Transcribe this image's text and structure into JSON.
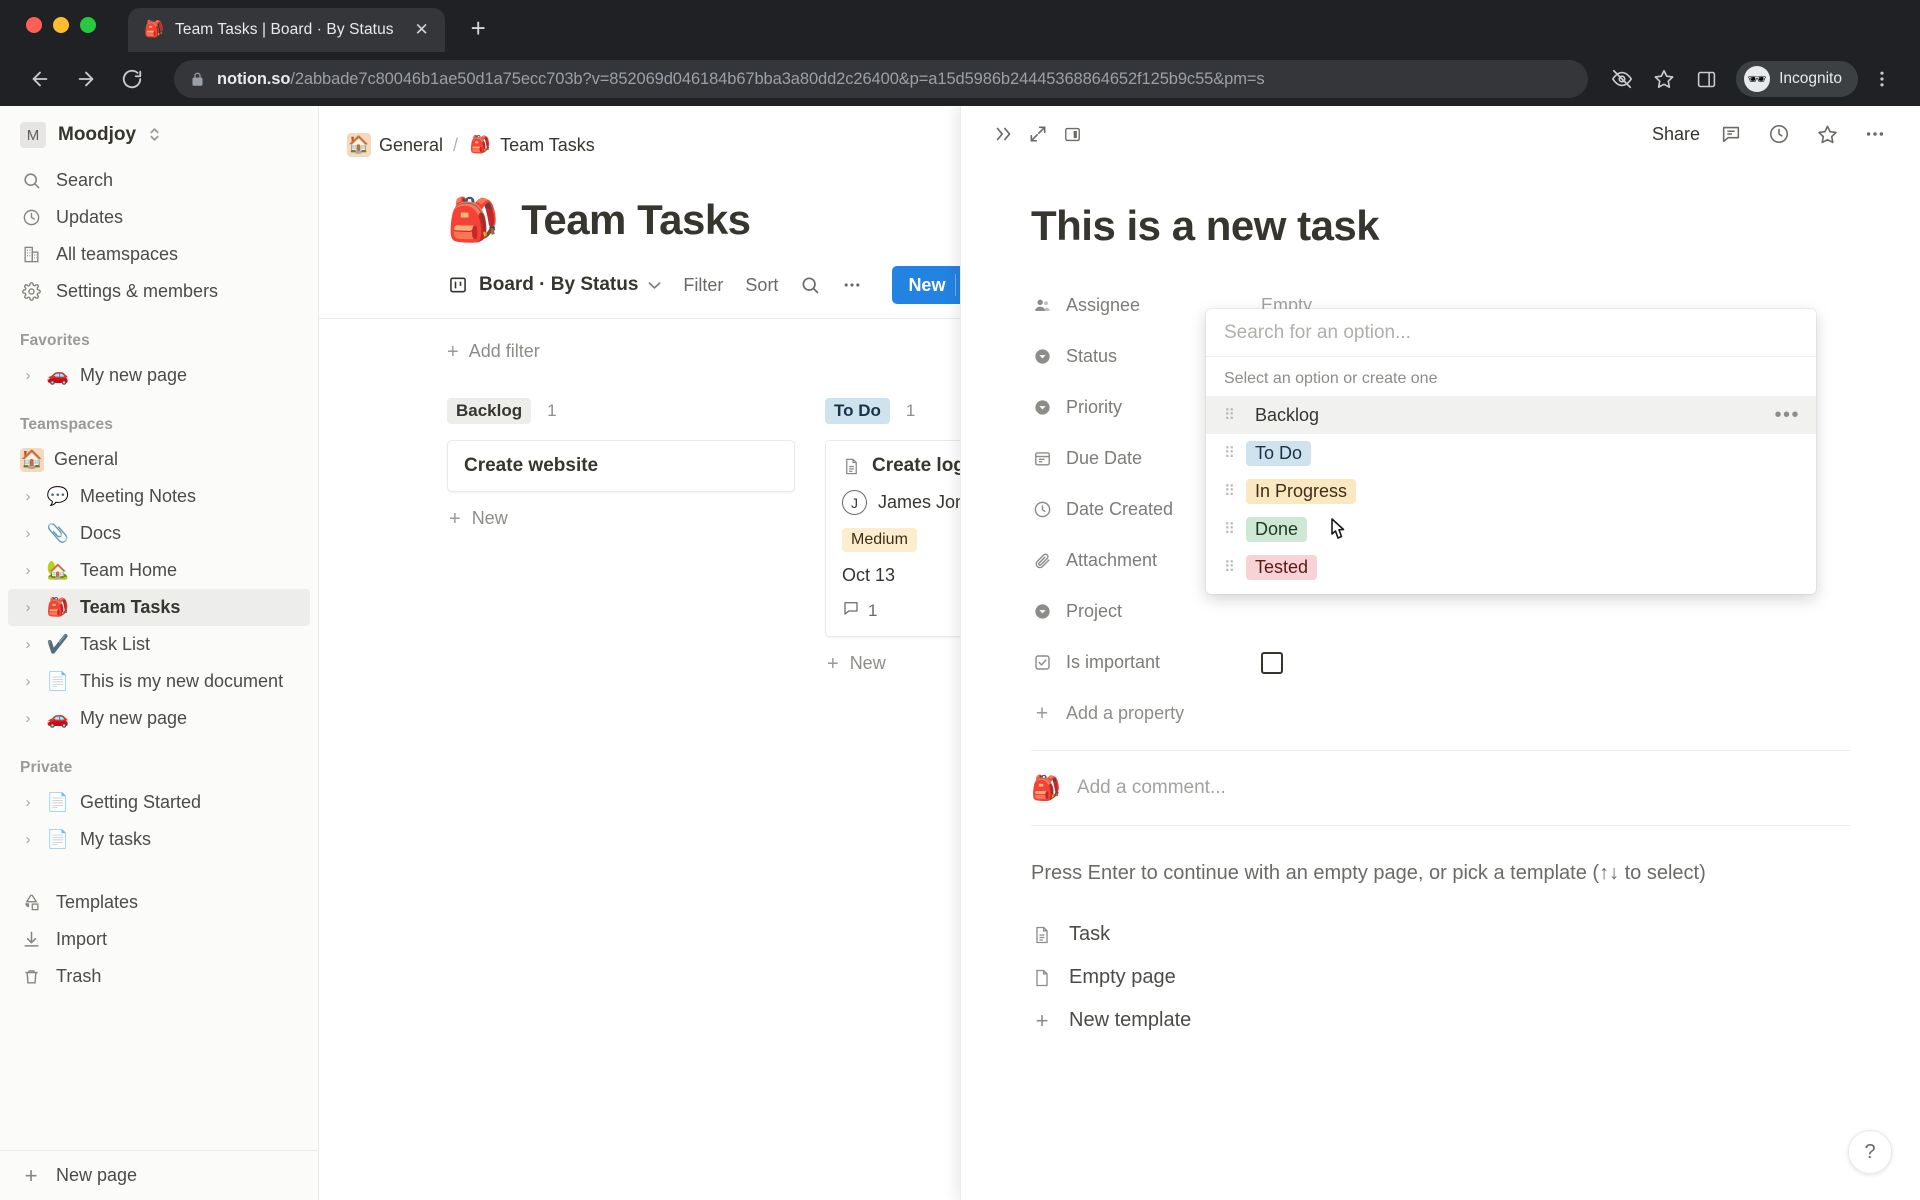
{
  "browser": {
    "tab": {
      "title": "Team Tasks | Board · By Status",
      "favicon": "🎒",
      "close": "✕"
    },
    "new_tab": "+",
    "url": {
      "host": "notion.so",
      "path": "/2abbade7c80046b1ae50d1a75ecc703b?v=852069d046184b67bba3a80dd2c26400&p=a15d5986b24445368864652f125b9c55&pm=s"
    },
    "profile": {
      "label": "Incognito",
      "avatar": "🕶"
    },
    "nav": {
      "back": "←",
      "forward": "→",
      "reload": "⟳"
    }
  },
  "sidebar": {
    "workspace": {
      "initial": "M",
      "name": "Moodjoy",
      "chevron": "⌃⌄"
    },
    "nav": [
      {
        "label": "Search",
        "icon": "search-icon"
      },
      {
        "label": "Updates",
        "icon": "clock-icon"
      },
      {
        "label": "All teamspaces",
        "icon": "building-icon"
      },
      {
        "label": "Settings & members",
        "icon": "gear-icon"
      }
    ],
    "sections": [
      {
        "title": "Favorites",
        "items": [
          {
            "label": "My new page",
            "emoji": "🚗",
            "chevron": true,
            "selected": false,
            "boxed": false
          }
        ]
      },
      {
        "title": "Teamspaces",
        "items": [
          {
            "label": "General",
            "emoji": "🏠",
            "chevron": false,
            "selected": false,
            "boxed": true
          },
          {
            "label": "Meeting Notes",
            "emoji": "💬",
            "chevron": true,
            "selected": false,
            "boxed": false
          },
          {
            "label": "Docs",
            "emoji": "📎",
            "chevron": true,
            "selected": false,
            "boxed": false
          },
          {
            "label": "Team Home",
            "emoji": "🏡",
            "chevron": true,
            "selected": false,
            "boxed": false
          },
          {
            "label": "Team Tasks",
            "emoji": "🎒",
            "chevron": true,
            "selected": true,
            "boxed": false
          },
          {
            "label": "Task List",
            "emoji": "✔️",
            "chevron": true,
            "selected": false,
            "boxed": false
          },
          {
            "label": "This is my new document",
            "emoji": "📄",
            "chevron": true,
            "selected": false,
            "boxed": false
          },
          {
            "label": "My new page",
            "emoji": "🚗",
            "chevron": true,
            "selected": false,
            "boxed": false
          }
        ]
      },
      {
        "title": "Private",
        "items": [
          {
            "label": "Getting Started",
            "emoji": "📄",
            "chevron": true,
            "selected": false,
            "boxed": false
          },
          {
            "label": "My tasks",
            "emoji": "📄",
            "chevron": true,
            "selected": false,
            "boxed": false
          }
        ]
      }
    ],
    "tools": [
      {
        "label": "Templates",
        "icon": "templates-icon"
      },
      {
        "label": "Import",
        "icon": "import-icon"
      },
      {
        "label": "Trash",
        "icon": "trash-icon"
      }
    ],
    "footer": {
      "label": "New page",
      "plus": "+"
    }
  },
  "board": {
    "breadcrumb": [
      {
        "label": "General",
        "emoji": "🏠",
        "boxed": true
      },
      {
        "label": "Team Tasks",
        "emoji": "🎒",
        "boxed": false
      }
    ],
    "breadcrumb_separator": "/",
    "title": "Team Tasks",
    "title_emoji": "🎒",
    "view": {
      "name": "Board · By Status",
      "chevron": "⌄"
    },
    "toolbar": {
      "filter": "Filter",
      "sort": "Sort",
      "search": "search-icon",
      "more": "•••",
      "new": "New",
      "new_chevron": "⌄"
    },
    "add_filter": {
      "plus": "+",
      "label": "Add filter"
    },
    "columns": [
      {
        "name": "Backlog",
        "count": "1",
        "chip_bg": "#ededec",
        "chip_fg": "#37352f",
        "cards": [
          {
            "title": "Create website",
            "has_icon": false
          }
        ],
        "new_label": "New"
      },
      {
        "name": "To Do",
        "count": "1",
        "chip_bg": "#cfe3ee",
        "chip_fg": "#183347",
        "cards": [
          {
            "title": "Create log",
            "has_icon": true,
            "assignee": "James Jona",
            "assignee_initial": "J",
            "priority": "Medium",
            "priority_bg": "#faeecd",
            "priority_fg": "#402c1b",
            "date": "Oct 13",
            "comments": "1"
          }
        ],
        "new_label": "New"
      }
    ]
  },
  "peek": {
    "topbar": {
      "expand_left": "»",
      "fullscreen": "expand-icon",
      "layout": "sidepeek-icon",
      "share": "Share",
      "comment": "comment-icon",
      "history": "clock-icon",
      "favorite": "star-icon",
      "more": "•••"
    },
    "title": "This is a new task",
    "properties": [
      {
        "label": "Assignee",
        "icon": "person-icon",
        "value": "Empty",
        "type": "text"
      },
      {
        "label": "Status",
        "icon": "select-icon",
        "value": "",
        "type": "text"
      },
      {
        "label": "Priority",
        "icon": "select-icon",
        "value": "",
        "type": "text"
      },
      {
        "label": "Due Date",
        "icon": "calendar-icon",
        "value": "",
        "type": "text"
      },
      {
        "label": "Date Created",
        "icon": "clock-icon",
        "value": "",
        "type": "text"
      },
      {
        "label": "Attachment",
        "icon": "paperclip-icon",
        "value": "",
        "type": "text"
      },
      {
        "label": "Project",
        "icon": "select-icon",
        "value": "",
        "type": "text"
      },
      {
        "label": "Is important",
        "icon": "checkbox-icon",
        "value": "",
        "type": "checkbox"
      }
    ],
    "add_property": {
      "plus": "+",
      "label": "Add a property"
    },
    "comment": {
      "avatar": "🎒",
      "placeholder": "Add a comment..."
    },
    "template_hint": "Press Enter to continue with an empty page, or pick a template (↑↓ to select)",
    "templates": [
      {
        "label": "Task",
        "icon": "doc-lines-icon"
      },
      {
        "label": "Empty page",
        "icon": "doc-blank-icon"
      },
      {
        "label": "New template",
        "icon": "plus-icon"
      }
    ]
  },
  "status_dropdown": {
    "search_placeholder": "Search for an option...",
    "hint": "Select an option or create one",
    "grip": "⠿",
    "more": "•••",
    "options": [
      {
        "label": "Backlog",
        "bg": "transparent",
        "fg": "#37352f",
        "hover": true,
        "show_more": true
      },
      {
        "label": "To Do",
        "bg": "#cfe3ee",
        "fg": "#183347",
        "hover": false,
        "show_more": false
      },
      {
        "label": "In Progress",
        "bg": "#fae8c0",
        "fg": "#402c1b",
        "hover": false,
        "show_more": false
      },
      {
        "label": "Done",
        "bg": "#cfe8d6",
        "fg": "#1c3829",
        "hover": false,
        "show_more": false
      },
      {
        "label": "Tested",
        "bg": "#f8d3d6",
        "fg": "#5d1715",
        "hover": false,
        "show_more": false
      }
    ]
  },
  "help": {
    "label": "?"
  },
  "colors": {
    "accent": "#2383e2",
    "chrome_bg": "#202124",
    "sidebar_bg": "#fbfbfa",
    "text": "#37352f"
  }
}
